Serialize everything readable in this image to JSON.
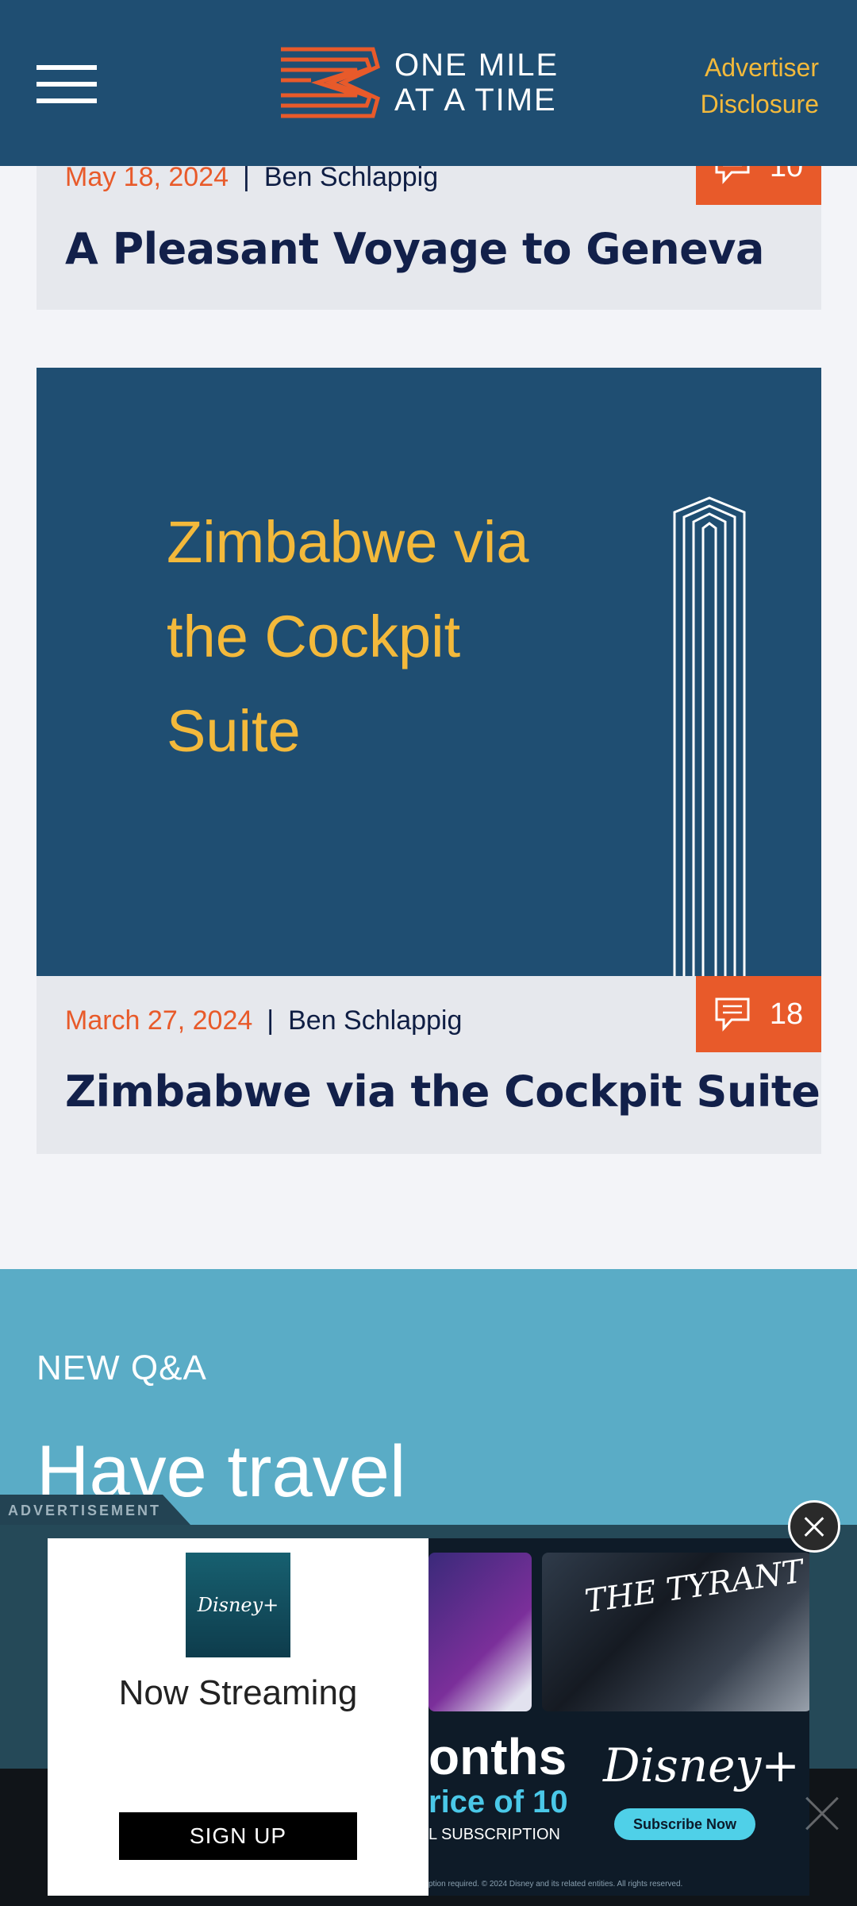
{
  "header": {
    "logo_line1": "ONE MILE",
    "logo_line2": "AT A TIME",
    "advertiser_line1": "Advertiser",
    "advertiser_line2": "Disclosure",
    "menu_icon": "hamburger-menu-icon"
  },
  "articles": [
    {
      "date": "May 18, 2024",
      "author": "Ben Schlappig",
      "comments": "10",
      "title": "A Pleasant Voyage to Geneva"
    },
    {
      "hero_line1": "Zimbabwe via",
      "hero_line2": "the Cockpit",
      "hero_line3": "Suite",
      "date": "March 27, 2024",
      "author": "Ben Schlappig",
      "comments": "18",
      "title": "Zimbabwe via the Cockpit Suite"
    }
  ],
  "qa": {
    "kicker": "NEW Q&A",
    "title_line1": "Have travel"
  },
  "ad": {
    "label": "ADVERTISEMENT",
    "logo_text": "Disney+",
    "tagline": "Now Streaming",
    "cta": "SIGN UP",
    "poster_text": "THE TYRANT",
    "months_text": "onths",
    "price_text": "rice of 10",
    "sub_text": "L SUBSCRIPTION",
    "brand": "Disney+",
    "subscribe": "Subscribe Now",
    "fine_print": "ption required. © 2024 Disney and its related entities. All rights reserved."
  },
  "colors": {
    "navy": "#1f4e72",
    "accent_orange": "#e85a2a",
    "accent_yellow": "#f3b93b",
    "qa_blue": "#5aacc6"
  }
}
